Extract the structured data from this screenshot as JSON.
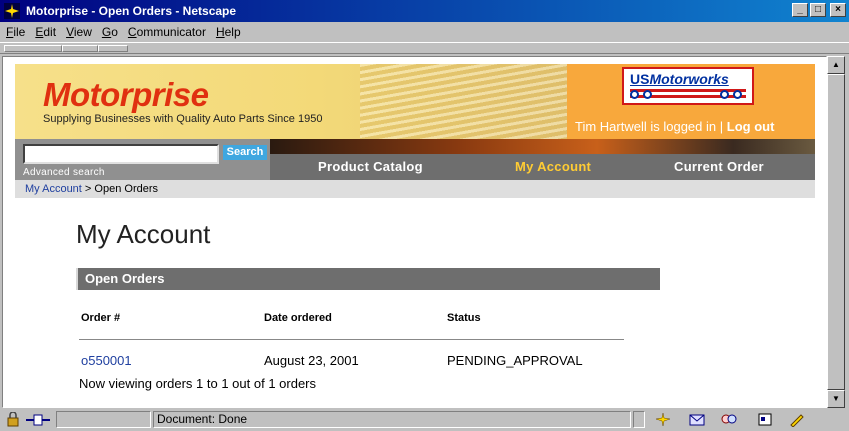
{
  "window": {
    "title": "Motorprise - Open Orders - Netscape"
  },
  "menu": {
    "items": [
      {
        "label": "File",
        "u": "F",
        "rest": "ile"
      },
      {
        "label": "Edit",
        "u": "E",
        "rest": "dit"
      },
      {
        "label": "View",
        "u": "V",
        "rest": "iew"
      },
      {
        "label": "Go",
        "u": "G",
        "rest": "o"
      },
      {
        "label": "Communicator",
        "u": "C",
        "rest": "ommunicator"
      },
      {
        "label": "Help",
        "u": "H",
        "rest": "elp"
      }
    ]
  },
  "site": {
    "logo": "Motorprise",
    "tagline": "Supplying Businesses with Quality Auto Parts Since 1950",
    "partner_logo_us": "US",
    "partner_logo_name": "Motorworks",
    "logged_in_text": "Tim Hartwell is logged in",
    "separator": "|",
    "logout": "Log out"
  },
  "search": {
    "value": "",
    "button": "Search",
    "advanced": "Advanced search"
  },
  "nav": {
    "items": [
      "Product Catalog",
      "My Account",
      "Current Order"
    ],
    "active": "My Account"
  },
  "breadcrumb": {
    "link": "My Account",
    "separator": ">",
    "current": "Open Orders"
  },
  "page": {
    "title": "My Account",
    "section": "Open Orders"
  },
  "orders": {
    "columns": [
      "Order #",
      "Date ordered",
      "Status"
    ],
    "rows": [
      {
        "order": "o550001",
        "date": "August 23, 2001",
        "status": "PENDING_APPROVAL"
      }
    ],
    "summary": "Now viewing orders 1 to 1 out of 1 orders"
  },
  "status": {
    "text": "Document: Done"
  },
  "colors": {
    "accent_red": "#e03010",
    "header_yellow": "#f3d978",
    "account_orange": "#f8a83c",
    "nav_gray": "#6e6e6e",
    "active_nav": "#ffcc33",
    "link_blue": "#2040a0"
  }
}
